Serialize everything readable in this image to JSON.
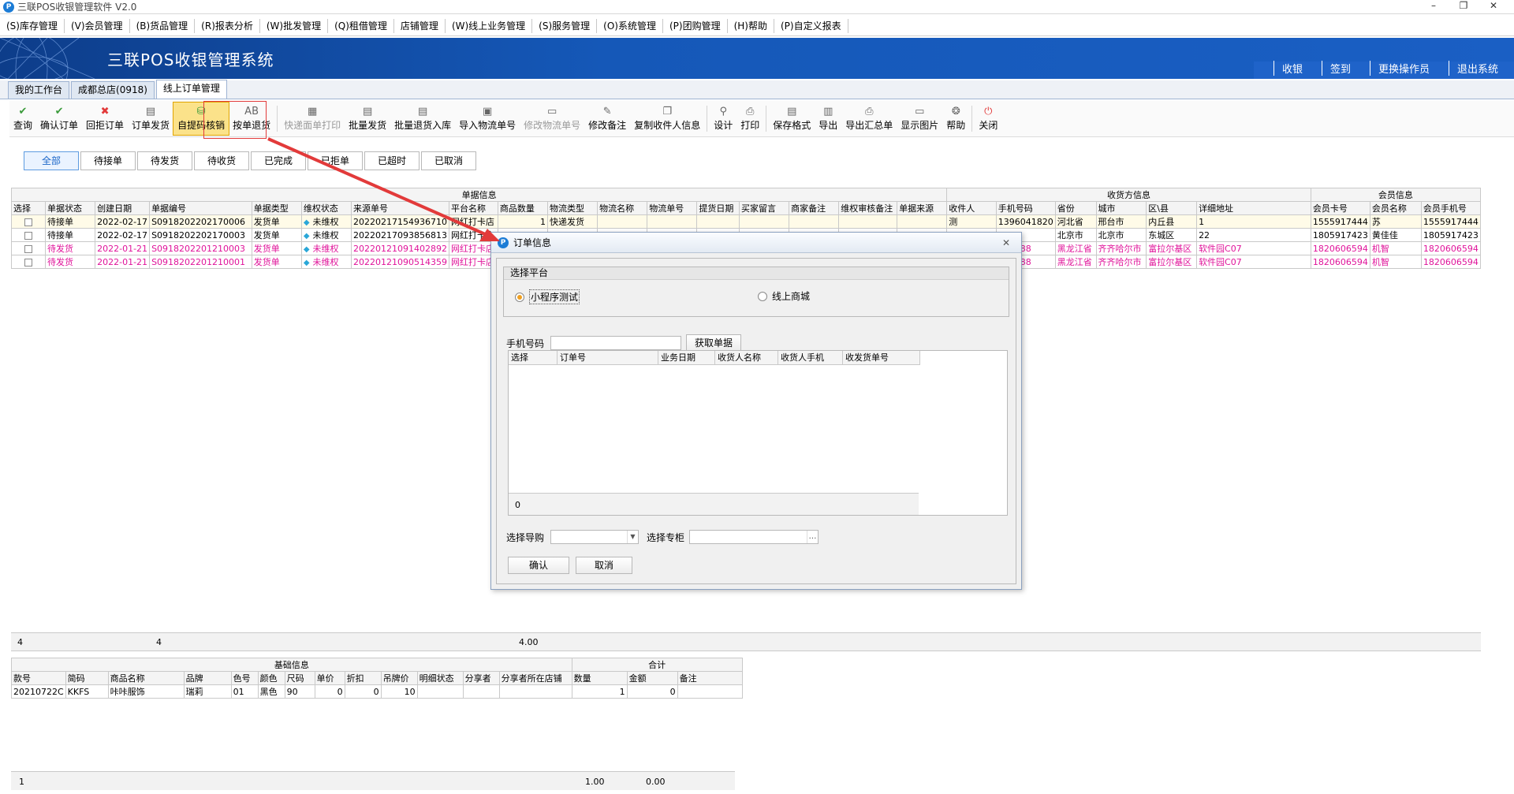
{
  "window": {
    "title": "三联POS收银管理软件 V2.0",
    "app_icon": "P",
    "controls": [
      "–",
      "❐",
      "✕"
    ]
  },
  "menu": [
    "(S)库存管理",
    "(V)会员管理",
    "(B)货品管理",
    "(R)报表分析",
    "(W)批发管理",
    "(Q)租借管理",
    "店铺管理",
    "(W)线上业务管理",
    "(S)服务管理",
    "(O)系统管理",
    "(P)团购管理",
    "(H)帮助",
    "(P)自定义报表"
  ],
  "banner": {
    "title": "三联POS收银管理系统",
    "links": [
      "收银",
      "签到",
      "更换操作员",
      "退出系统"
    ]
  },
  "tabs": [
    "我的工作台",
    "成都总店(0918)",
    "线上订单管理"
  ],
  "toolbar": [
    {
      "label": "查询",
      "icon": "search-icon",
      "glyph": "✔",
      "state": "normal"
    },
    {
      "label": "确认订单",
      "icon": "check-icon",
      "glyph": "✔",
      "state": "normal"
    },
    {
      "label": "回拒订单",
      "icon": "reject-icon",
      "glyph": "✖",
      "state": "normal"
    },
    {
      "label": "订单发货",
      "icon": "ship-icon",
      "glyph": "▤",
      "state": "normal"
    },
    {
      "label": "自提码核销",
      "icon": "basket-icon",
      "glyph": "⛁",
      "state": "highlight"
    },
    {
      "label": "按单退货",
      "icon": "return-icon",
      "glyph": "AB",
      "state": "normal"
    },
    {
      "label": "快递面单打印",
      "icon": "print-label-icon",
      "glyph": "▦",
      "state": "disabled"
    },
    {
      "label": "批量发货",
      "icon": "batch-ship-icon",
      "glyph": "▤",
      "state": "normal"
    },
    {
      "label": "批量退货入库",
      "icon": "batch-return-icon",
      "glyph": "▤",
      "state": "normal"
    },
    {
      "label": "导入物流单号",
      "icon": "import-icon",
      "glyph": "▣",
      "state": "normal"
    },
    {
      "label": "修改物流单号",
      "icon": "edit-logistics-icon",
      "glyph": "▭",
      "state": "disabled"
    },
    {
      "label": "修改备注",
      "icon": "edit-note-icon",
      "glyph": "✎",
      "state": "normal"
    },
    {
      "label": "复制收件人信息",
      "icon": "copy-icon",
      "glyph": "❐",
      "state": "normal"
    },
    {
      "label": "设计",
      "icon": "design-icon",
      "glyph": "⚲",
      "state": "normal"
    },
    {
      "label": "打印",
      "icon": "print-icon",
      "glyph": "⎙",
      "state": "normal"
    },
    {
      "label": "保存格式",
      "icon": "save-format-icon",
      "glyph": "▤",
      "state": "normal"
    },
    {
      "label": "导出",
      "icon": "export-icon",
      "glyph": "▥",
      "state": "normal"
    },
    {
      "label": "导出汇总单",
      "icon": "export-summary-icon",
      "glyph": "⎙",
      "state": "normal"
    },
    {
      "label": "显示图片",
      "icon": "image-icon",
      "glyph": "▭",
      "state": "normal"
    },
    {
      "label": "帮助",
      "icon": "help-icon",
      "glyph": "❂",
      "state": "normal"
    },
    {
      "label": "关闭",
      "icon": "power-icon",
      "glyph": "⏻",
      "state": "normal"
    }
  ],
  "filters": [
    "全部",
    "待接单",
    "待发货",
    "待收货",
    "已完成",
    "已拒单",
    "已超时",
    "已取消"
  ],
  "grid": {
    "groups": [
      "单据信息",
      "收货方信息",
      "会员信息"
    ],
    "columns": [
      "选择",
      "单据状态",
      "创建日期",
      "单据编号",
      "单据类型",
      "维权状态",
      "来源单号",
      "平台名称",
      "商品数量",
      "物流类型",
      "物流名称",
      "物流单号",
      "提货日期",
      "买家留言",
      "商家备注",
      "维权审核备注",
      "单据来源",
      "收件人",
      "手机号码",
      "省份",
      "城市",
      "区\\县",
      "详细地址",
      "会员卡号",
      "会员名称",
      "会员手机号"
    ],
    "rows": [
      [
        "",
        "待接单",
        "2022-02-17",
        "S0918202202170006",
        "发货单",
        "未维权",
        "20220217154936710",
        "网红打卡店",
        "1",
        "快递发货",
        "",
        "",
        "",
        "",
        "",
        "",
        "",
        "测",
        "1396041820",
        "河北省",
        "邢台市",
        "内丘县",
        "1",
        "1555917444",
        "苏",
        "1555917444"
      ],
      [
        "",
        "待接单",
        "2022-02-17",
        "S0918202202170003",
        "发货单",
        "未维权",
        "20220217093856813",
        "网红打卡店",
        "",
        "",
        "",
        "",
        "",
        "",
        "",
        "",
        "",
        "",
        "",
        "北京市",
        "北京市",
        "东城区",
        "22",
        "1805917423",
        "黄佳佳",
        "1805917423"
      ],
      [
        "",
        "待发货",
        "2022-01-21",
        "S0918202201210003",
        "发货单",
        "未维权",
        "20220121091402892",
        "网红打卡店",
        "",
        "",
        "",
        "",
        "",
        "",
        "",
        "",
        "",
        "",
        "555888",
        "黑龙江省",
        "齐齐哈尔市",
        "富拉尔基区",
        "软件园C07",
        "1820606594",
        "机智",
        "1820606594"
      ],
      [
        "",
        "待发货",
        "2022-01-21",
        "S0918202201210001",
        "发货单",
        "未维权",
        "20220121090514359",
        "网红打卡店",
        "",
        "",
        "",
        "",
        "",
        "",
        "",
        "",
        "",
        "",
        "555888",
        "黑龙江省",
        "齐齐哈尔市",
        "富拉尔基区",
        "软件园C07",
        "1820606594",
        "机智",
        "1820606594"
      ]
    ],
    "summary": {
      "count": "4",
      "doc_count": "4",
      "qty": "4.00"
    }
  },
  "detail": {
    "groups": [
      "基础信息",
      "合计"
    ],
    "columns": [
      "款号",
      "简码",
      "商品名称",
      "品牌",
      "色号",
      "颜色",
      "尺码",
      "单价",
      "折扣",
      "吊牌价",
      "明细状态",
      "分享者",
      "分享者所在店铺",
      "数量",
      "金额",
      "备注"
    ],
    "rows": [
      [
        "20210722C",
        "KKFS",
        "咔咔服饰",
        "瑞莉",
        "01",
        "黑色",
        "90",
        "0",
        "0",
        "10",
        "",
        "",
        "",
        "1",
        "0",
        ""
      ]
    ],
    "footer": {
      "count": "1",
      "qty": "1.00",
      "amount": "0.00"
    }
  },
  "dialog": {
    "title": "订单信息",
    "close": "✕",
    "platform_legend": "选择平台",
    "platform_options": [
      "小程序测试",
      "线上商城"
    ],
    "selected_platform": "小程序测试",
    "phone_label": "手机号码",
    "phone_value": "",
    "fetch_button": "获取单据",
    "columns": [
      "选择",
      "订单号",
      "业务日期",
      "收货人名称",
      "收货人手机",
      "收发货单号"
    ],
    "footer_count": "0",
    "guide_label": "选择导购",
    "guide_value": "",
    "counter_label": "选择专柜",
    "counter_value": "",
    "confirm_button": "确认",
    "cancel_button": "取消"
  },
  "colors": {
    "banner": "#1558b8",
    "pink_row": "#e0139a",
    "annotation": "#e23a3a",
    "highlight": "#fbe28a"
  }
}
